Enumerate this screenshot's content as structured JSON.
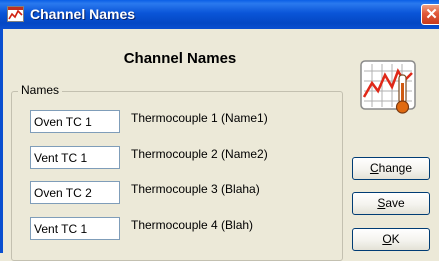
{
  "window": {
    "title": "Channel Names",
    "close_glyph": "✕",
    "icon": "chart-app-icon"
  },
  "heading": "Channel Names",
  "group": {
    "label": "Names",
    "rows": [
      {
        "name": "Oven TC 1",
        "label": "Thermocouple   1 (Name1)"
      },
      {
        "name": "Vent TC 1",
        "label": "Thermocouple   2 (Name2)"
      },
      {
        "name": "Oven TC 2",
        "label": "Thermocouple   3 (Blaha)"
      },
      {
        "name": "Vent TC 1",
        "label": "Thermocouple   4 (Blah)"
      }
    ]
  },
  "buttons": {
    "change": {
      "mnemonic": "C",
      "rest": "hange"
    },
    "save": {
      "mnemonic": "S",
      "rest": "ave"
    },
    "ok": {
      "mnemonic": "O",
      "rest": "K"
    }
  },
  "colors": {
    "titlebar": "#0a55d8",
    "window_bg": "#ece9d8",
    "close": "#e0583a"
  }
}
